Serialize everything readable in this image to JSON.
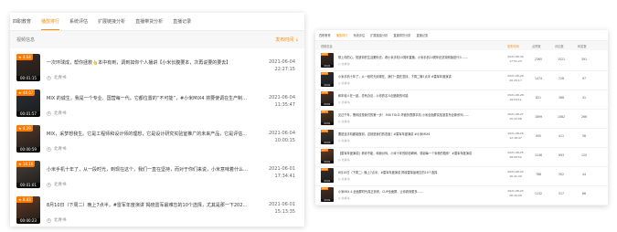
{
  "left": {
    "tabs": [
      "四职教育",
      "播放排行",
      "系统评估",
      "扩展链接分析",
      "直播带货分析",
      "直播记录"
    ],
    "active_tab": 1,
    "header": {
      "title": "视频信息",
      "sort": "发布时间 ↓"
    },
    "items": [
      {
        "rating": "4.64",
        "duration": "00:01:15",
        "title": "一次环球成，帮你拯救👆本中有到，调到如你个人播讲【小米长腹要本，次再说要的要去】",
        "author": "北青书",
        "date": "2021-06-04",
        "time": "22:27:15",
        "thumb_color": "#3d2a22"
      },
      {
        "rating": "44.67",
        "duration": "00:01:57",
        "title": "MIX 的诚生，我是一个专业、国营每一代。它都位置的“不可能”，#小米MIX4 将要使调在生产制造……",
        "author": "北青书",
        "date": "2021-06-04",
        "time": "11:35:47",
        "thumb_color": "#2c2f38"
      },
      {
        "rating": "4.29",
        "duration": "00:00:59",
        "title": "MIX，采梦想我生。它是工程师和设计师的理想，它是设计研究实验室推广的未来产品，它是评估个下一个领域的……",
        "author": "北青书",
        "date": "2021-06-04",
        "time": "10:00:15",
        "thumb_color": "#5a3a28"
      },
      {
        "rating": "14.16",
        "duration": "00:01:01",
        "title": "小米手机十年了，从一段时光，到现在这个，我们一直在坚持，而对于你们来说，小米意味着什么呢？",
        "author": "北青书",
        "date": "2021-06-01",
        "time": "17:34:41",
        "thumb_color": "#4a4038"
      },
      {
        "rating": "8.83",
        "duration": "00:00:23",
        "title": "8月10日（下周二）晚上7点半，#雷军年度演讲 揭晓雷军最难忘的10个选择，尤其是那一下2020年的……",
        "author": "北青书",
        "date": "2021-06-01",
        "time": "15:13:35",
        "thumb_color": "#6a3a20"
      }
    ]
  },
  "right": {
    "tabs": [
      "四职教育",
      "播放排行",
      "系统评估",
      "扩展链接分析",
      "直播带货分析",
      "直播记录"
    ],
    "active_tab": 1,
    "columns": [
      "视频信息",
      "发布时间",
      "点赞数",
      "评论数",
      "转发数"
    ],
    "rows": [
      {
        "rating": "4.5",
        "duration": "00:01",
        "title": "带上你的心，知道你的生活跟你去，看小米手机10周年直播，小米手机10周年纪念特别版是什么……",
        "author": "北青书",
        "date": "2021-08-30",
        "time": "17:51:23",
        "likes": "2365",
        "comments": "1521",
        "shares": "391",
        "thumb_color": "#3a2a20"
      },
      {
        "rating": "4.2",
        "duration": "00:02",
        "title": "小米手机十年了，从一段时光到现在，我们一直在坚持，下周二晚7点半 #雷军年度演讲",
        "author": "北青书",
        "date": "2021-08-29",
        "time": "20:29:17",
        "likes": "1474",
        "comments": "728",
        "shares": "97",
        "thumb_color": "#2a2d36"
      },
      {
        "rating": "3.8",
        "duration": "00:01",
        "title": "和年轻人在一起，总有办法，以你的名义创造新的可能",
        "author": "北青书",
        "date": "2021-08-28",
        "time": "19:04:11",
        "likes": "821",
        "comments": "368",
        "shares": "41",
        "thumb_color": "#4b3226"
      },
      {
        "rating": "5.1",
        "duration": "00:01",
        "title": "见过千年，黑科技是我们的第一步！ MIX FOLD 环面折叠屏手机 小米全面屏实验室发布全新系列……",
        "author": "北青书",
        "date": "2021-08-27",
        "time": "15:32:08",
        "likes": "1899",
        "comments": "1082",
        "shares": "266",
        "thumb_color": "#56381f"
      },
      {
        "rating": "4.0",
        "duration": "00:00",
        "title": "要是连手机都能做到，这就是我们的态度！#雷军年度演讲 #小米MIX4",
        "author": "北青书",
        "date": "2021-08-26",
        "time": "12:18:47",
        "likes": "955",
        "comments": "411",
        "shares": "58",
        "thumb_color": "#403a33"
      },
      {
        "rating": "4.7",
        "duration": "00:01",
        "title": "【雷军年度演讲】看你不能，和我对你，小米十年的精彩瞬间，感谢每一个米粉的陪伴！#雷军年度演讲",
        "author": "北青书",
        "date": "2021-08-25",
        "time": "18:06:52",
        "likes": "1246",
        "comments": "693",
        "shares": "120",
        "thumb_color": "#6a3b22"
      },
      {
        "rating": "3.9",
        "duration": "00:01",
        "title": "8月10日（下周二）晚上7点半，#雷军年度演讲 揭晓雷军最难忘的10个选择",
        "author": "北青书",
        "date": "2021-08-24",
        "time": "16:41:30",
        "likes": "788",
        "comments": "302",
        "shares": "44",
        "thumb_color": "#33302c"
      },
      {
        "rating": "4.4",
        "duration": "00:02",
        "title": "小米MIX 4 全面屏时代真正到来，CUP全面屏，让你看到更多……",
        "author": "北青书",
        "date": "2021-08-23",
        "time": "20:15:09",
        "likes": "1132",
        "comments": "517",
        "shares": "86",
        "thumb_color": "#4a2e22"
      }
    ]
  }
}
